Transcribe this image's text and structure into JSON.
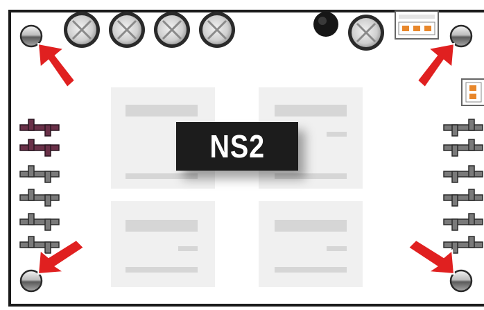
{
  "board": {
    "label": "NS2",
    "colors": {
      "outline": "#1a1a1a",
      "arrow": "#e02020",
      "module": "#f0f0f0",
      "module_bar": "#d6d6d6",
      "connector": "#e8872b",
      "pin_dark": "#6a3048"
    },
    "top_capacitors": 4,
    "left_pins": 6,
    "right_pins": 6,
    "modules": 4,
    "mounting_holes": 4,
    "arrows": 4
  }
}
